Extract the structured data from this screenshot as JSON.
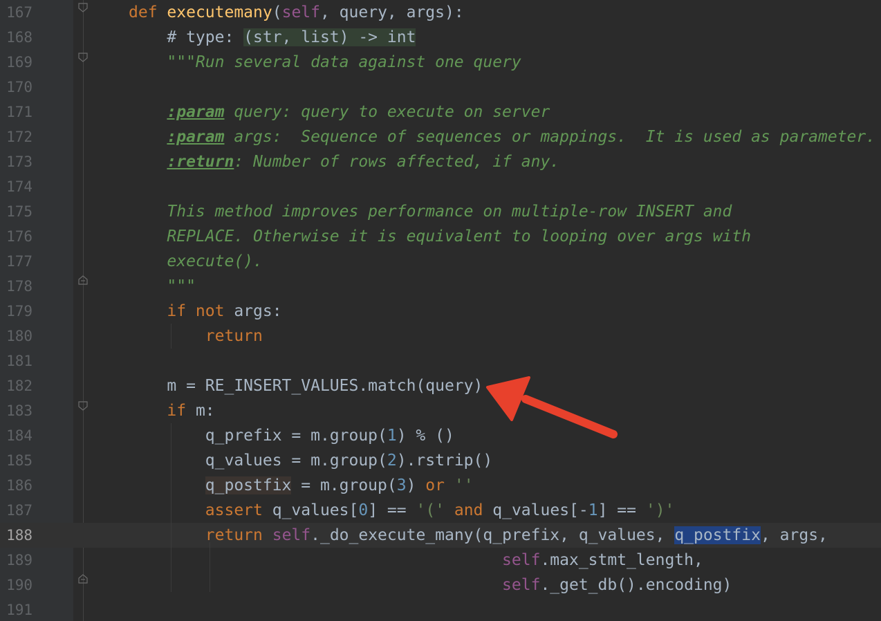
{
  "editor": {
    "current_line": "188",
    "lines": [
      {
        "number": "167",
        "segments": [
          {
            "t": "def",
            "c": "kw"
          },
          {
            "t": " "
          },
          {
            "t": "executemany",
            "c": "fn"
          },
          {
            "t": "("
          },
          {
            "t": "self",
            "c": "self"
          },
          {
            "t": ", query, args):"
          }
        ]
      },
      {
        "number": "168",
        "segments": [
          {
            "t": "    # type: "
          },
          {
            "t": "(str, list) -> int",
            "c": "typehint"
          }
        ]
      },
      {
        "number": "169",
        "segments": [
          {
            "t": "    "
          },
          {
            "t": "\"\"\"Run several data against one query",
            "c": "doc"
          }
        ]
      },
      {
        "number": "170",
        "segments": []
      },
      {
        "number": "171",
        "segments": [
          {
            "t": "    "
          },
          {
            "t": ":param",
            "c": "tag"
          },
          {
            "t": " query: query to execute on server",
            "c": "doc"
          }
        ]
      },
      {
        "number": "172",
        "segments": [
          {
            "t": "    "
          },
          {
            "t": ":param",
            "c": "tag"
          },
          {
            "t": " args:  Sequence of sequences or mappings.  It is used as parameter.",
            "c": "doc"
          }
        ]
      },
      {
        "number": "173",
        "segments": [
          {
            "t": "    "
          },
          {
            "t": ":return",
            "c": "tag"
          },
          {
            "t": ": Number of rows affected, if any.",
            "c": "doc"
          }
        ]
      },
      {
        "number": "174",
        "segments": []
      },
      {
        "number": "175",
        "segments": [
          {
            "t": "    "
          },
          {
            "t": "This method improves performance on multiple-row INSERT and",
            "c": "doc"
          }
        ]
      },
      {
        "number": "176",
        "segments": [
          {
            "t": "    "
          },
          {
            "t": "REPLACE. Otherwise it is equivalent to looping over args with",
            "c": "doc"
          }
        ]
      },
      {
        "number": "177",
        "segments": [
          {
            "t": "    "
          },
          {
            "t": "execute().",
            "c": "doc"
          }
        ]
      },
      {
        "number": "178",
        "segments": [
          {
            "t": "    "
          },
          {
            "t": "\"\"\"",
            "c": "doc"
          }
        ]
      },
      {
        "number": "179",
        "segments": [
          {
            "t": "    "
          },
          {
            "t": "if not",
            "c": "kw"
          },
          {
            "t": " args:"
          }
        ]
      },
      {
        "number": "180",
        "segments": [
          {
            "t": "        "
          },
          {
            "t": "return",
            "c": "kw"
          }
        ]
      },
      {
        "number": "181",
        "segments": []
      },
      {
        "number": "182",
        "segments": [
          {
            "t": "    m = RE_INSERT_VALUES.match(query)"
          }
        ]
      },
      {
        "number": "183",
        "segments": [
          {
            "t": "    "
          },
          {
            "t": "if",
            "c": "kw"
          },
          {
            "t": " m:"
          }
        ]
      },
      {
        "number": "184",
        "segments": [
          {
            "t": "        q_prefix = m.group("
          },
          {
            "t": "1",
            "c": "num"
          },
          {
            "t": ") % ()"
          }
        ]
      },
      {
        "number": "185",
        "segments": [
          {
            "t": "        q_values = m.group("
          },
          {
            "t": "2",
            "c": "num"
          },
          {
            "t": ").rstrip()"
          }
        ]
      },
      {
        "number": "186",
        "segments": [
          {
            "t": "        "
          },
          {
            "t": "q_postfix",
            "c": "hl"
          },
          {
            "t": " = m.group("
          },
          {
            "t": "3",
            "c": "num"
          },
          {
            "t": ") "
          },
          {
            "t": "or",
            "c": "kw"
          },
          {
            "t": " "
          },
          {
            "t": "''",
            "c": "str"
          }
        ]
      },
      {
        "number": "187",
        "segments": [
          {
            "t": "        "
          },
          {
            "t": "assert",
            "c": "kw"
          },
          {
            "t": " q_values["
          },
          {
            "t": "0",
            "c": "num"
          },
          {
            "t": "] == "
          },
          {
            "t": "'('",
            "c": "str"
          },
          {
            "t": " "
          },
          {
            "t": "and",
            "c": "kw"
          },
          {
            "t": " q_values[-"
          },
          {
            "t": "1",
            "c": "num"
          },
          {
            "t": "] == "
          },
          {
            "t": "')'",
            "c": "str"
          }
        ]
      },
      {
        "number": "188",
        "segments": [
          {
            "t": "        "
          },
          {
            "t": "return",
            "c": "kw"
          },
          {
            "t": " "
          },
          {
            "t": "self",
            "c": "self"
          },
          {
            "t": "._do_execute_many(q_prefix, q_values, "
          },
          {
            "t": "q_postfix",
            "c": "sel"
          },
          {
            "t": ", args,"
          }
        ]
      },
      {
        "number": "189",
        "segments": [
          {
            "t": "                                       "
          },
          {
            "t": "self",
            "c": "self"
          },
          {
            "t": ".max_stmt_length,"
          }
        ]
      },
      {
        "number": "190",
        "segments": [
          {
            "t": "                                       "
          },
          {
            "t": "self",
            "c": "self"
          },
          {
            "t": "._get_db().encoding)"
          }
        ]
      },
      {
        "number": "191",
        "segments": []
      }
    ]
  },
  "annotation": {
    "arrow_color": "#e8412c",
    "points_to_line": "182"
  },
  "colors": {
    "background": "#2b2b2b",
    "gutter": "#313335",
    "keyword": "#cc7832",
    "function": "#ffc66d",
    "self": "#94558d",
    "number": "#6897bb",
    "string": "#6a8759",
    "docstring": "#629755",
    "selection": "#214283",
    "default_text": "#a9b7c6"
  }
}
